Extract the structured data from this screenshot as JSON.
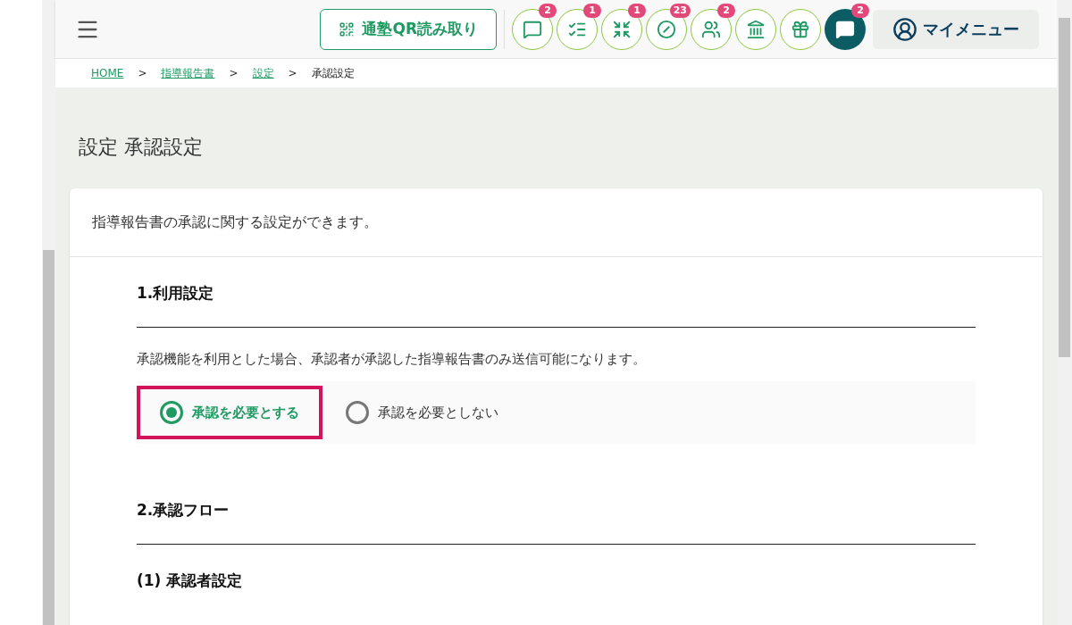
{
  "header": {
    "qr_button": "通塾QR読み取り",
    "icon_buttons": [
      {
        "kind": "chat",
        "badge": "2",
        "active": false
      },
      {
        "kind": "checklist",
        "badge": "1",
        "active": false
      },
      {
        "kind": "merge",
        "badge": "1",
        "active": false
      },
      {
        "kind": "blocked",
        "badge": "23",
        "active": false
      },
      {
        "kind": "group",
        "badge": "2",
        "active": false
      },
      {
        "kind": "bank",
        "active": false
      },
      {
        "kind": "gift",
        "active": false
      },
      {
        "kind": "message",
        "badge": "2",
        "active": true
      }
    ],
    "my_menu": "マイメニュー"
  },
  "breadcrumb": [
    {
      "label": "HOME",
      "link": true
    },
    {
      "label": "指導報告書",
      "link": true
    },
    {
      "label": "設定",
      "link": true
    },
    {
      "label": "承認設定",
      "link": false
    }
  ],
  "breadcrumb_separator": ">",
  "page_title": "設定 承認設定",
  "card": {
    "description": "指導報告書の承認に関する設定ができます。",
    "sections": [
      {
        "kind": "usage",
        "heading": "1.利用設定",
        "note": "承認機能を利用とした場合、承認者が承認した指導報告書のみ送信可能になります。",
        "options": [
          {
            "label": "承認を必要とする",
            "selected": true,
            "highlighted": true
          },
          {
            "label": "承認を必要としない",
            "selected": false,
            "highlighted": false
          }
        ]
      },
      {
        "kind": "flow",
        "heading": "2.承認フロー",
        "subheading": "(1) 承認者設定"
      }
    ]
  }
}
